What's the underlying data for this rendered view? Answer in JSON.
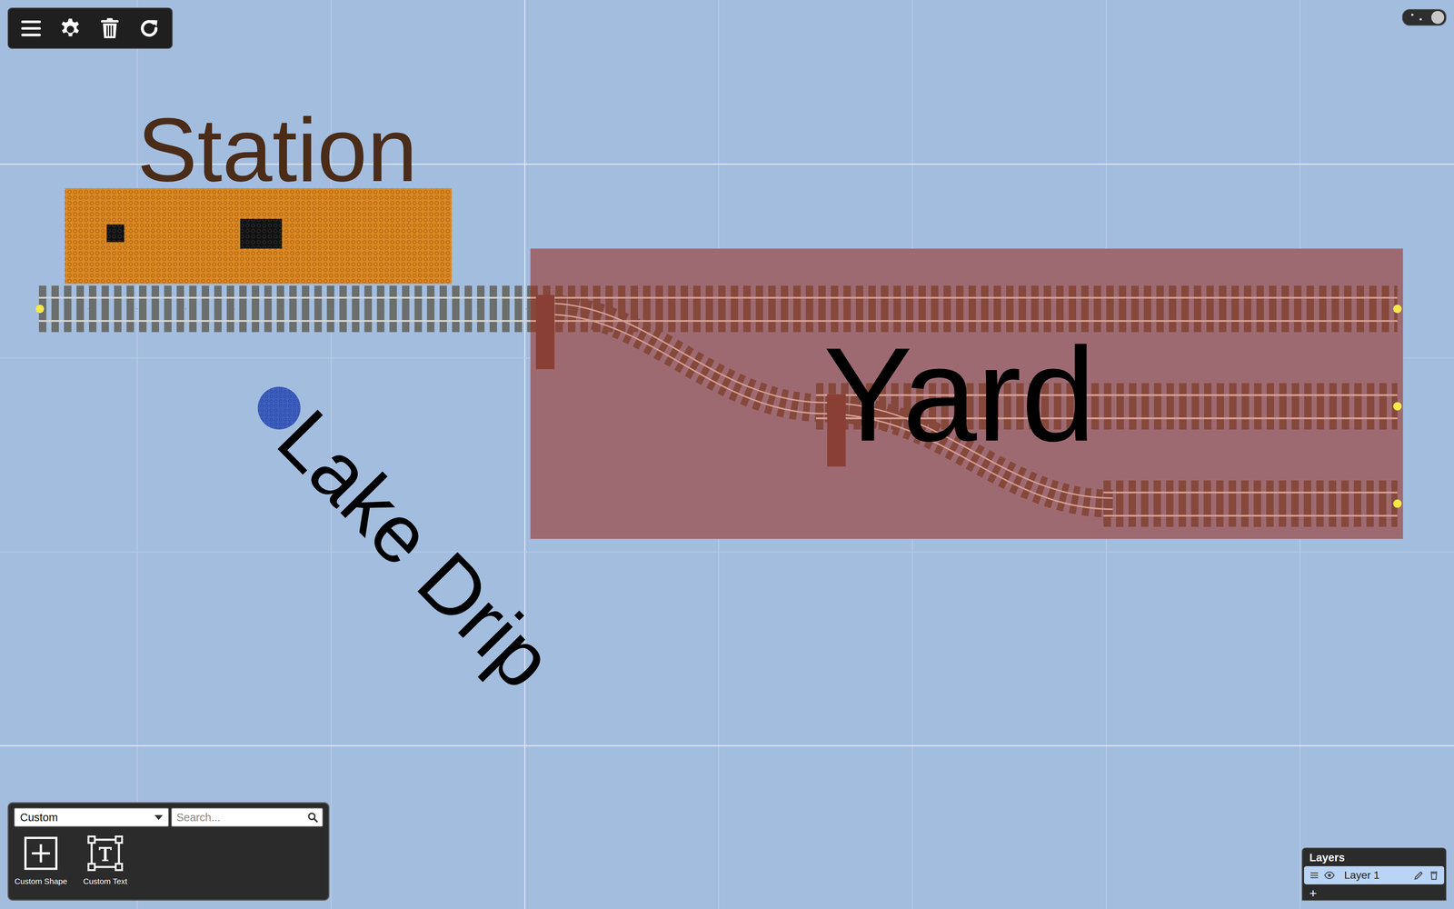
{
  "canvas": {
    "labels": [
      {
        "text": "Station",
        "color": "#4a2c18"
      },
      {
        "text": "Yard",
        "color": "#000000"
      },
      {
        "text": "Lake Drip",
        "color": "#000000"
      }
    ]
  },
  "palette": {
    "category": "Custom",
    "search": {
      "placeholder": "Search..."
    },
    "items": [
      {
        "label": "Custom Shape"
      },
      {
        "label": "Custom Text"
      }
    ]
  },
  "layers": {
    "title": "Layers",
    "add": "+",
    "items": [
      {
        "name": "Layer 1",
        "visible": true,
        "selected": true
      }
    ]
  }
}
